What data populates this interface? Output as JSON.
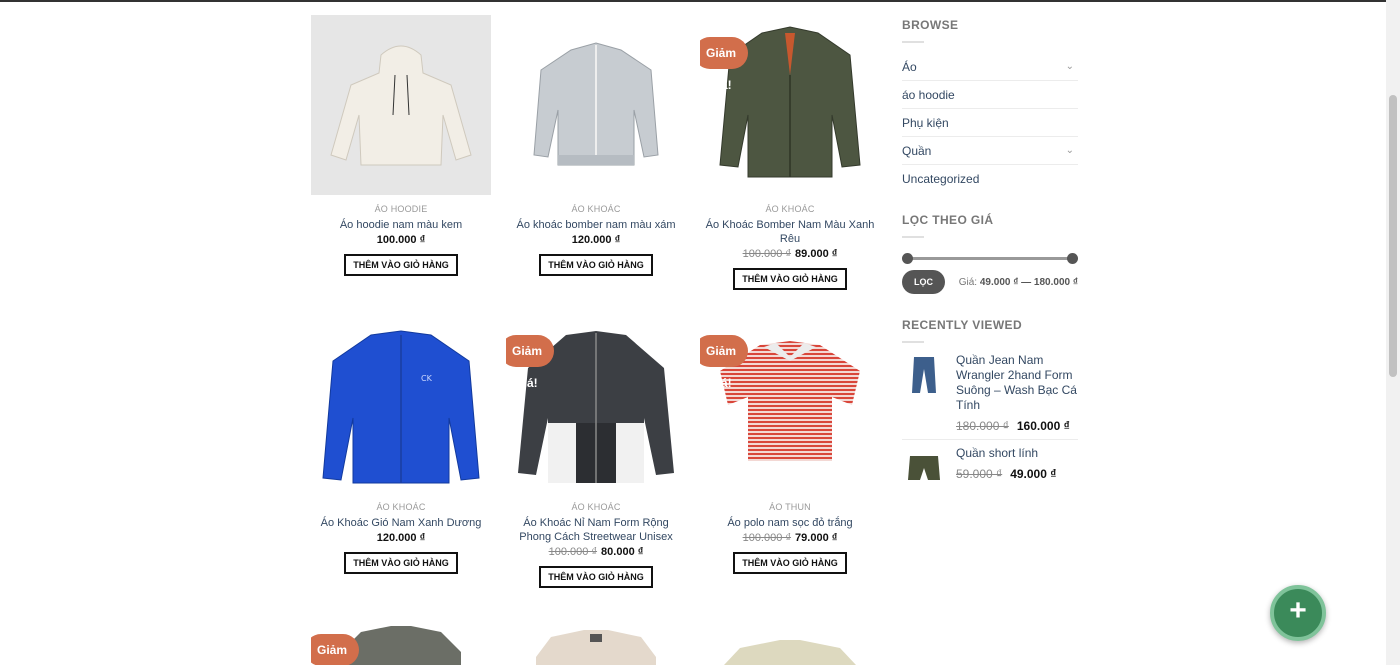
{
  "products": [
    {
      "category": "Áo hoodie",
      "title": "Áo hoodie nam màu kem",
      "price": "100.000 ₫",
      "old_price": "",
      "sale": "",
      "button": "THÊM VÀO GIỎ HÀNG",
      "image": "cream-hoodie"
    },
    {
      "category": "Áo khoác",
      "title": "Áo khoác bomber nam màu xám",
      "price": "120.000 ₫",
      "old_price": "",
      "sale": "",
      "button": "THÊM VÀO GIỎ HÀNG",
      "image": "grey-bomber-jacket"
    },
    {
      "category": "Áo khoác",
      "title": "Áo Khoác Bomber Nam Màu Xanh Rêu",
      "price": "89.000 ₫",
      "old_price": "100.000 ₫",
      "sale": "Giảm giá!",
      "button": "THÊM VÀO GIỎ HÀNG",
      "image": "olive-bomber-jacket"
    },
    {
      "category": "Áo khoác",
      "title": "Áo Khoác Gió Nam Xanh Dương",
      "price": "120.000 ₫",
      "old_price": "",
      "sale": "",
      "button": "THÊM VÀO GIỎ HÀNG",
      "image": "blue-windbreaker"
    },
    {
      "category": "Áo khoác",
      "title": "Áo Khoác Nỉ Nam Form Rộng Phong Cách Streetwear Unisex",
      "price": "80.000 ₫",
      "old_price": "100.000 ₫",
      "sale": "Giảm giá!",
      "button": "THÊM VÀO GIỎ HÀNG",
      "image": "black-white-track-jacket"
    },
    {
      "category": "Áo thun",
      "title": "Áo polo nam sọc đỏ trắng",
      "price": "79.000 ₫",
      "old_price": "100.000 ₫",
      "sale": "Giảm giá!",
      "button": "THÊM VÀO GIỎ HÀNG",
      "image": "red-striped-polo"
    },
    {
      "sale": "Giảm giá!",
      "image": "grey-shirt"
    },
    {
      "image": "beige-shirt"
    },
    {
      "image": "striped-shirt"
    }
  ],
  "sidebar": {
    "browse_title": "BROWSE",
    "categories": [
      "Áo",
      "áo hoodie",
      "Phụ kiện",
      "Quần",
      "Uncategorized"
    ],
    "filter_title": "LỌC THEO GIÁ",
    "filter_button": "LỌC",
    "price_label": "Giá:",
    "price_range": "49.000 ₫ — 180.000 ₫",
    "recent_title": "RECENTLY VIEWED",
    "recent": [
      {
        "title": "Quần Jean Nam Wrangler 2hand Form Suông – Wash Bạc Cá Tính",
        "old_price": "180.000 ₫",
        "price": "160.000 ₫",
        "image": "jeans-icon"
      },
      {
        "title": "Quần short lính",
        "old_price": "59.000 ₫",
        "price": "49.000 ₫",
        "image": "shorts-icon"
      }
    ]
  },
  "fab_icon": "+",
  "colors": {
    "sale_badge": "#d26e4b",
    "link": "#334862",
    "fab": "#3b8a5a"
  }
}
